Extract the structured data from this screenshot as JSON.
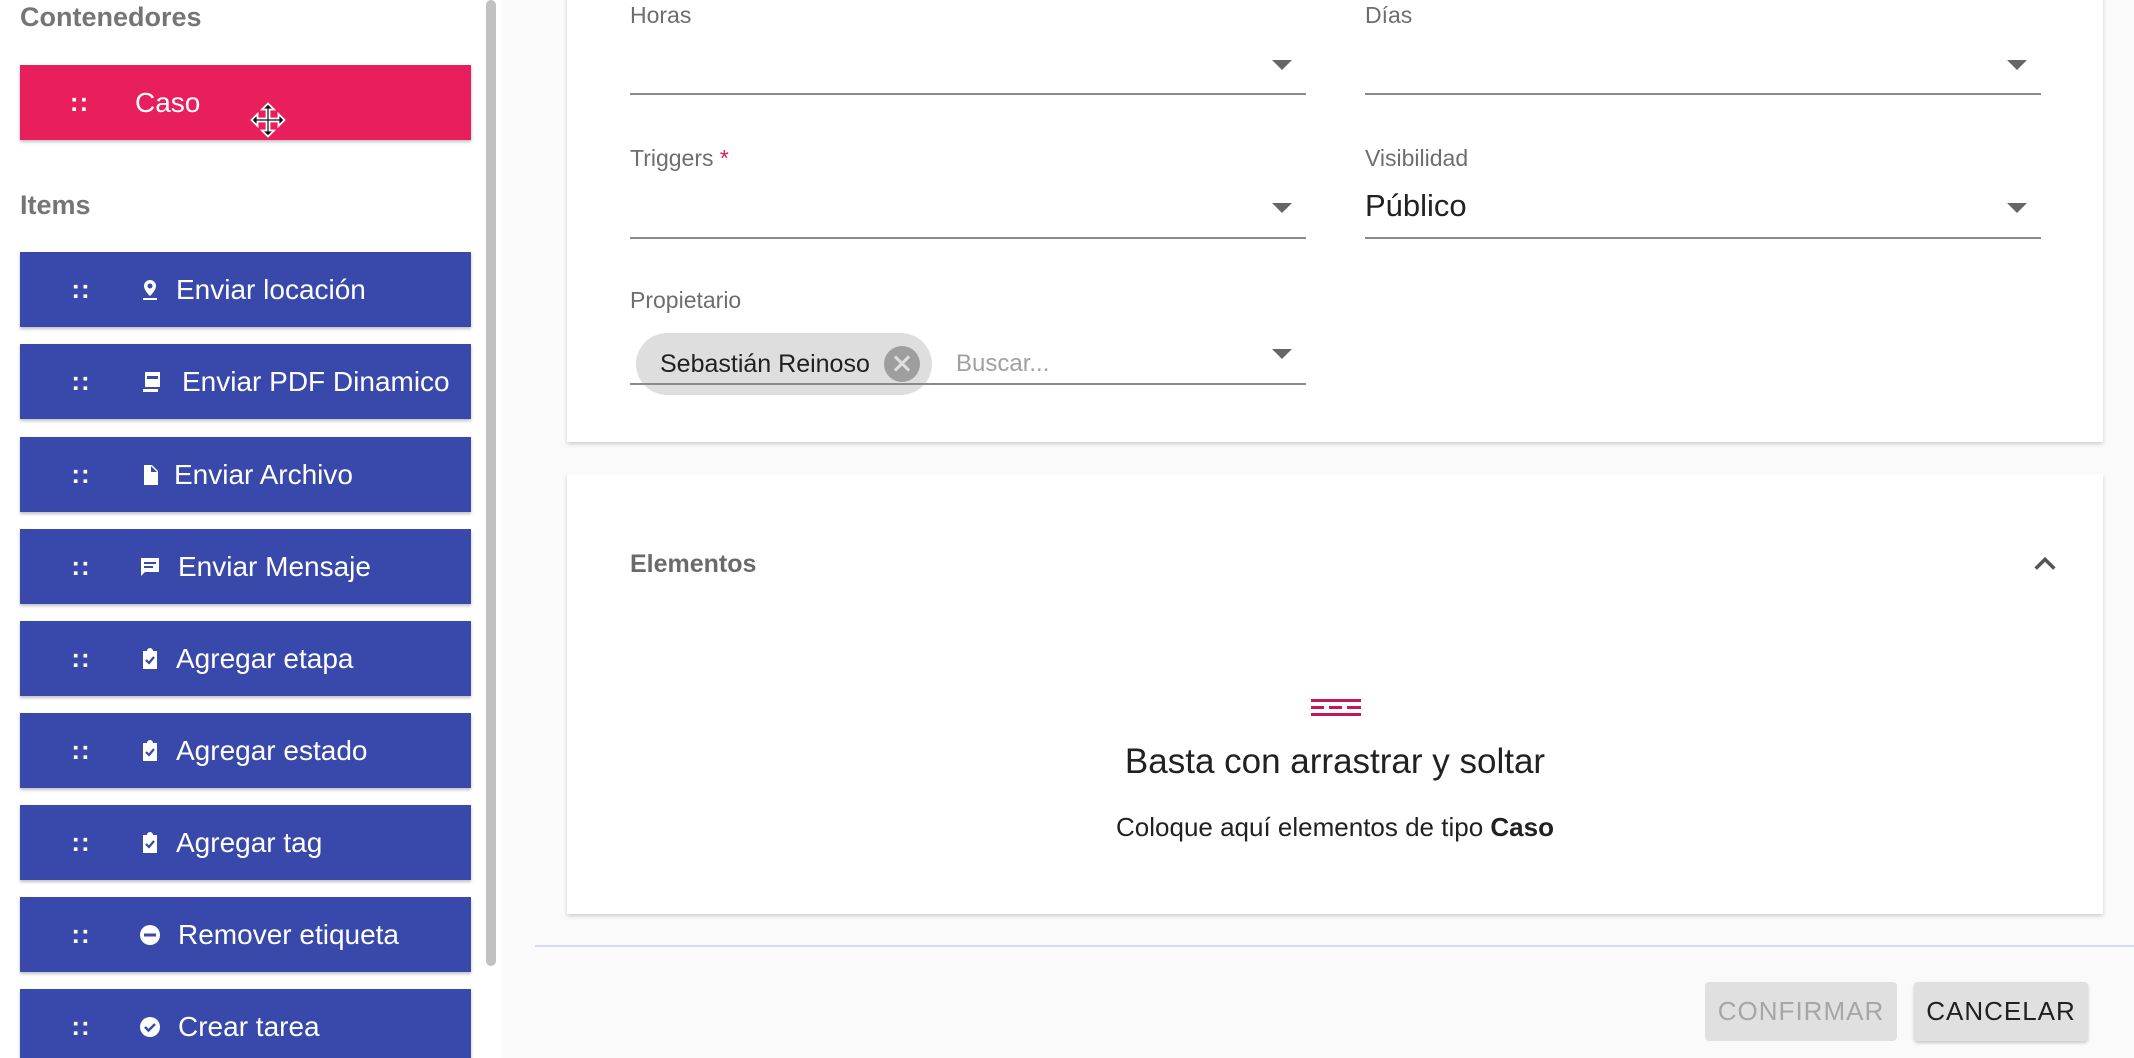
{
  "sidebar": {
    "containers_title": "Contenedores",
    "containers": [
      {
        "label": "Caso",
        "handle": "::"
      }
    ],
    "items_title": "Items",
    "items": [
      {
        "label": "Enviar locación",
        "handle": "::",
        "icon": "location-pin-icon"
      },
      {
        "label": "Enviar PDF Dinamico",
        "handle": "::",
        "icon": "pdf-icon"
      },
      {
        "label": "Enviar Archivo",
        "handle": "::",
        "icon": "file-icon"
      },
      {
        "label": "Enviar Mensaje",
        "handle": "::",
        "icon": "message-icon"
      },
      {
        "label": "Agregar etapa",
        "handle": "::",
        "icon": "clipboard-check-icon"
      },
      {
        "label": "Agregar estado",
        "handle": "::",
        "icon": "clipboard-check-icon"
      },
      {
        "label": "Agregar tag",
        "handle": "::",
        "icon": "clipboard-check-icon"
      },
      {
        "label": "Remover etiqueta",
        "handle": "::",
        "icon": "minus-circle-icon"
      },
      {
        "label": "Crear tarea",
        "handle": "::",
        "icon": "check-circle-icon"
      }
    ]
  },
  "form": {
    "horas": {
      "label": "Horas",
      "value": ""
    },
    "dias": {
      "label": "Días",
      "value": ""
    },
    "triggers": {
      "label": "Triggers",
      "required_mark": "*",
      "value": ""
    },
    "visibilidad": {
      "label": "Visibilidad",
      "value": "Público"
    },
    "propietario": {
      "label": "Propietario",
      "chip": "Sebastián Reinoso",
      "search_placeholder": "Buscar..."
    }
  },
  "elements": {
    "title": "Elementos",
    "drop_title": "Basta con arrastrar y soltar",
    "drop_sub_prefix": "Coloque aquí elementos de tipo ",
    "drop_sub_type": "Caso"
  },
  "footer": {
    "confirm_label": "CONFIRMAR",
    "cancel_label": "CANCELAR"
  },
  "colors": {
    "container": "#e91e5c",
    "item": "#3949ab",
    "accent": "#d81b60"
  }
}
